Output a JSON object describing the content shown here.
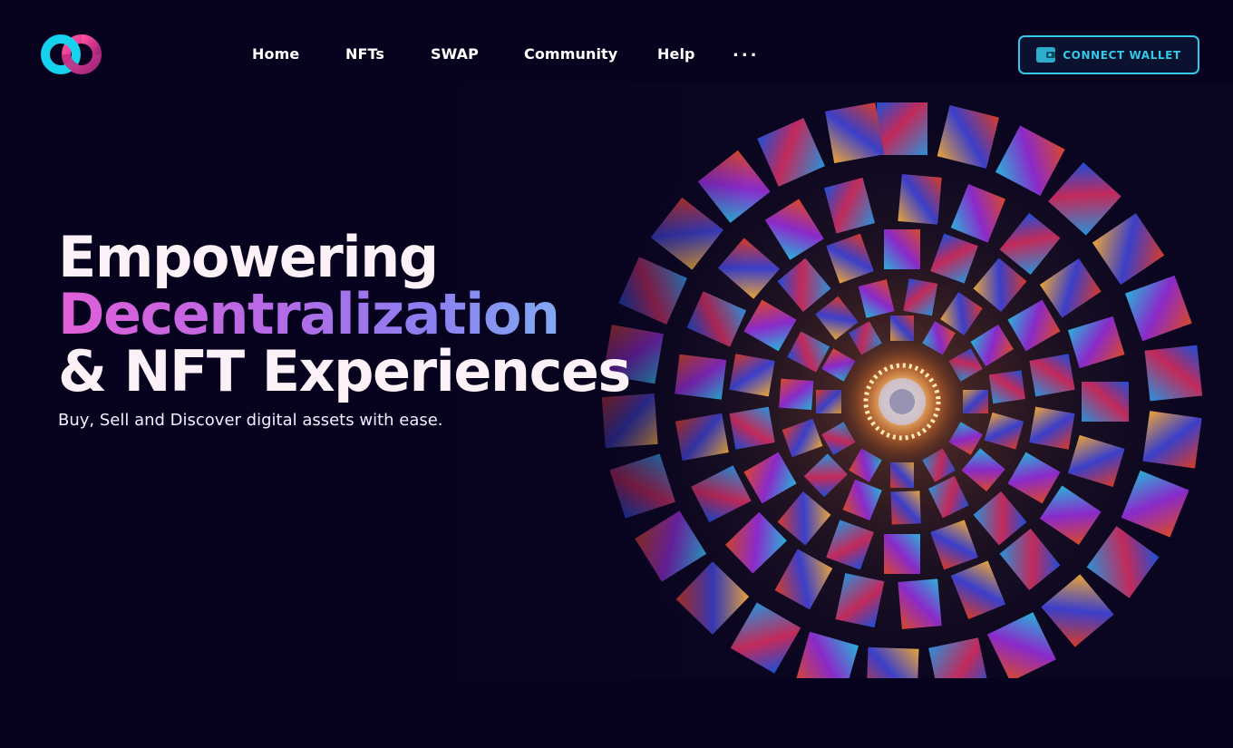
{
  "brand": {
    "logo_icon": "infinity-logo-icon",
    "logo_colors": [
      "#19d3ee",
      "#e4398f"
    ]
  },
  "nav": {
    "links": [
      {
        "label": "Home"
      },
      {
        "label": "NFTs"
      },
      {
        "label": "SWAP"
      },
      {
        "label": "Community"
      },
      {
        "label": "Help"
      }
    ],
    "more_label": "..."
  },
  "connect_wallet": {
    "label": "CONNECT WALLET",
    "icon": "wallet-icon",
    "accent": "#35c9e8"
  },
  "hero": {
    "line1": "Empowering",
    "line2": "Decentralization",
    "line3": "& NFT Experiences",
    "subtitle": "Buy, Sell and Discover digital assets with ease.",
    "image": "stained-glass-spiral-ceiling",
    "gradient_colors": [
      "#e15fd8",
      "#8d7ff0",
      "#7cc1f3"
    ]
  },
  "colors": {
    "background": "#07031f",
    "text": "#ffffff"
  }
}
